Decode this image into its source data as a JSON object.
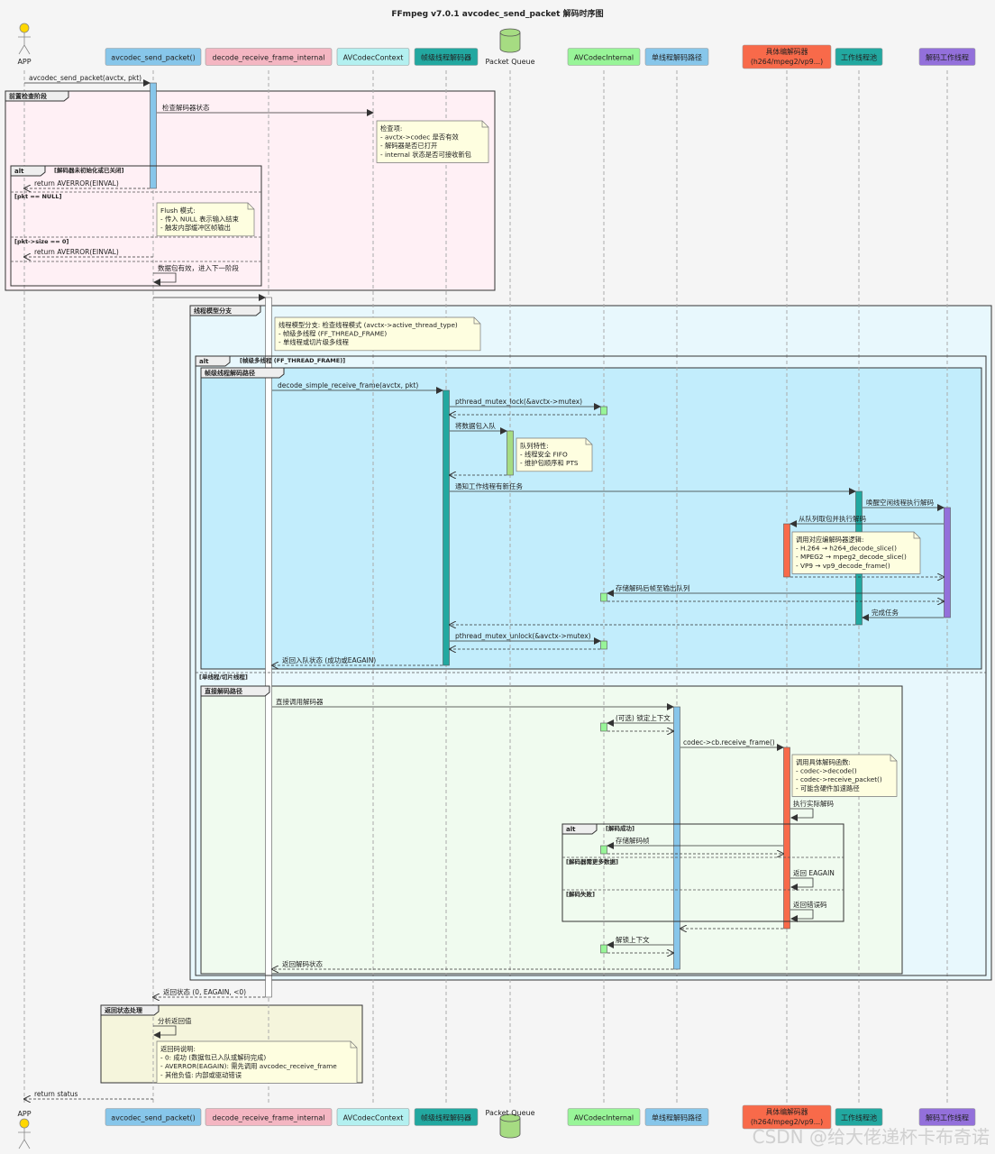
{
  "title": "FFmpeg v7.0.1 avcodec_send_packet 解码时序图",
  "colors": {
    "background": "#f5f5f5",
    "actor_head": "#ffd700",
    "send_packet": "#87c6ea",
    "decode_receive": "#f4b6c2",
    "avcodeccontext": "#b3f0f0",
    "frame_decoder": "#22a8a0",
    "packet_queue": "#a6dc82",
    "avcodecinternal": "#98f598",
    "single_path": "#87c6ea",
    "codec": "#f86a4a",
    "worker_pool": "#22a8a0",
    "worker_thread": "#9370db",
    "precheck_bg": "#fff0f5",
    "thread_model_bg": "#e8f8fd",
    "frame_path_bg": "#c2edfc",
    "direct_path_bg": "#f0fbef",
    "return_bg": "#f5f5dc",
    "note_bg": "#fefee0"
  },
  "participants": [
    {
      "id": "app",
      "label": "APP",
      "kind": "actor"
    },
    {
      "id": "send",
      "label": "avcodec_send_packet()"
    },
    {
      "id": "recv",
      "label": "decode_receive_frame_internal"
    },
    {
      "id": "ctx",
      "label": "AVCodecContext"
    },
    {
      "id": "fdec",
      "label": "帧级线程解码器"
    },
    {
      "id": "queue",
      "label": "Packet Queue",
      "kind": "database"
    },
    {
      "id": "internal",
      "label": "AVCodecInternal"
    },
    {
      "id": "single",
      "label": "单线程解码路径"
    },
    {
      "id": "codec",
      "label": "具体编解码器",
      "label2": "(h264/mpeg2/vp9...)"
    },
    {
      "id": "pool",
      "label": "工作线程池"
    },
    {
      "id": "worker",
      "label": "解码工作线程"
    }
  ],
  "groups": {
    "precheck": "前置检查阶段",
    "thread_model": "线程模型分支",
    "frame_path": "帧级线程解码路径",
    "direct_path": "直接解码路径",
    "return_proc": "返回状态处理",
    "alt": "alt"
  },
  "conditions": {
    "c1": "[解码器未初始化或已关闭]",
    "c2": "[pkt == NULL]",
    "c3": "[pkt->size == 0]",
    "c4": "[帧级多线程 (FF_THREAD_FRAME)]",
    "c5": "[单线程/切片线程]",
    "c6": "[解码成功]",
    "c7": "[解码器需更多数据]",
    "c8": "[解码失败]"
  },
  "messages": {
    "m1": "avcodec_send_packet(avctx, pkt)",
    "m2": "检查解码器状态",
    "m3": "return AVERROR(EINVAL)",
    "m4": "return AVERROR(EINVAL)",
    "m5": "数据包有效，进入下一阶段",
    "m6": "decode_simple_receive_frame(avctx, pkt)",
    "m7": "pthread_mutex_lock(&avctx->mutex)",
    "m8": "将数据包入队",
    "m9": "通知工作线程有新任务",
    "m10": "唤醒空闲线程执行解码",
    "m11": "从队列取包并执行解码",
    "m12": "存储解码后帧至输出队列",
    "m13": "完成任务",
    "m14": "pthread_mutex_unlock(&avctx->mutex)",
    "m15": "返回入队状态 (成功或EAGAIN)",
    "m16": "直接调用解码器",
    "m17": "(可选) 锁定上下文",
    "m18": "codec->cb.receive_frame()",
    "m19": "执行实际解码",
    "m20": "存储解码帧",
    "m21": "返回 EAGAIN",
    "m22": "返回错误码",
    "m23": "解锁上下文",
    "m24": "返回解码状态",
    "m25": "返回状态 (0, EAGAIN, <0)",
    "m26": "分析返回值",
    "m27": "return status"
  },
  "notes": {
    "n1": [
      "检查项:",
      "- avctx->codec 是否有效",
      "- 解码器是否已打开",
      "- internal 状态是否可接收新包"
    ],
    "n2": [
      "Flush 模式:",
      "- 传入 NULL 表示输入结束",
      "- 触发内部缓冲区帧输出"
    ],
    "n3": [
      "线程模型分支: 检查线程模式 (avctx->active_thread_type)",
      "- 帧级多线程 (FF_THREAD_FRAME)",
      "- 单线程或切片级多线程"
    ],
    "n4": [
      "队列特性:",
      "- 线程安全 FIFO",
      "- 维护包顺序和 PTS"
    ],
    "n5": [
      "调用对应编解码器逻辑:",
      "- H.264 → h264_decode_slice()",
      "- MPEG2 → mpeg2_decode_slice()",
      "- VP9 → vp9_decode_frame()"
    ],
    "n6": [
      "调用具体解码函数:",
      "- codec->decode()",
      "- codec->receive_packet()",
      "- 可能含硬件加速路径"
    ],
    "n7": [
      "返回码说明:",
      "- 0: 成功 (数据包已入队或解码完成)",
      "- AVERROR(EAGAIN): 需先调用 avcodec_receive_frame",
      "- 其他负值: 内部或驱动错误"
    ]
  },
  "watermark": "CSDN @给大佬递杯卡布奇诺"
}
